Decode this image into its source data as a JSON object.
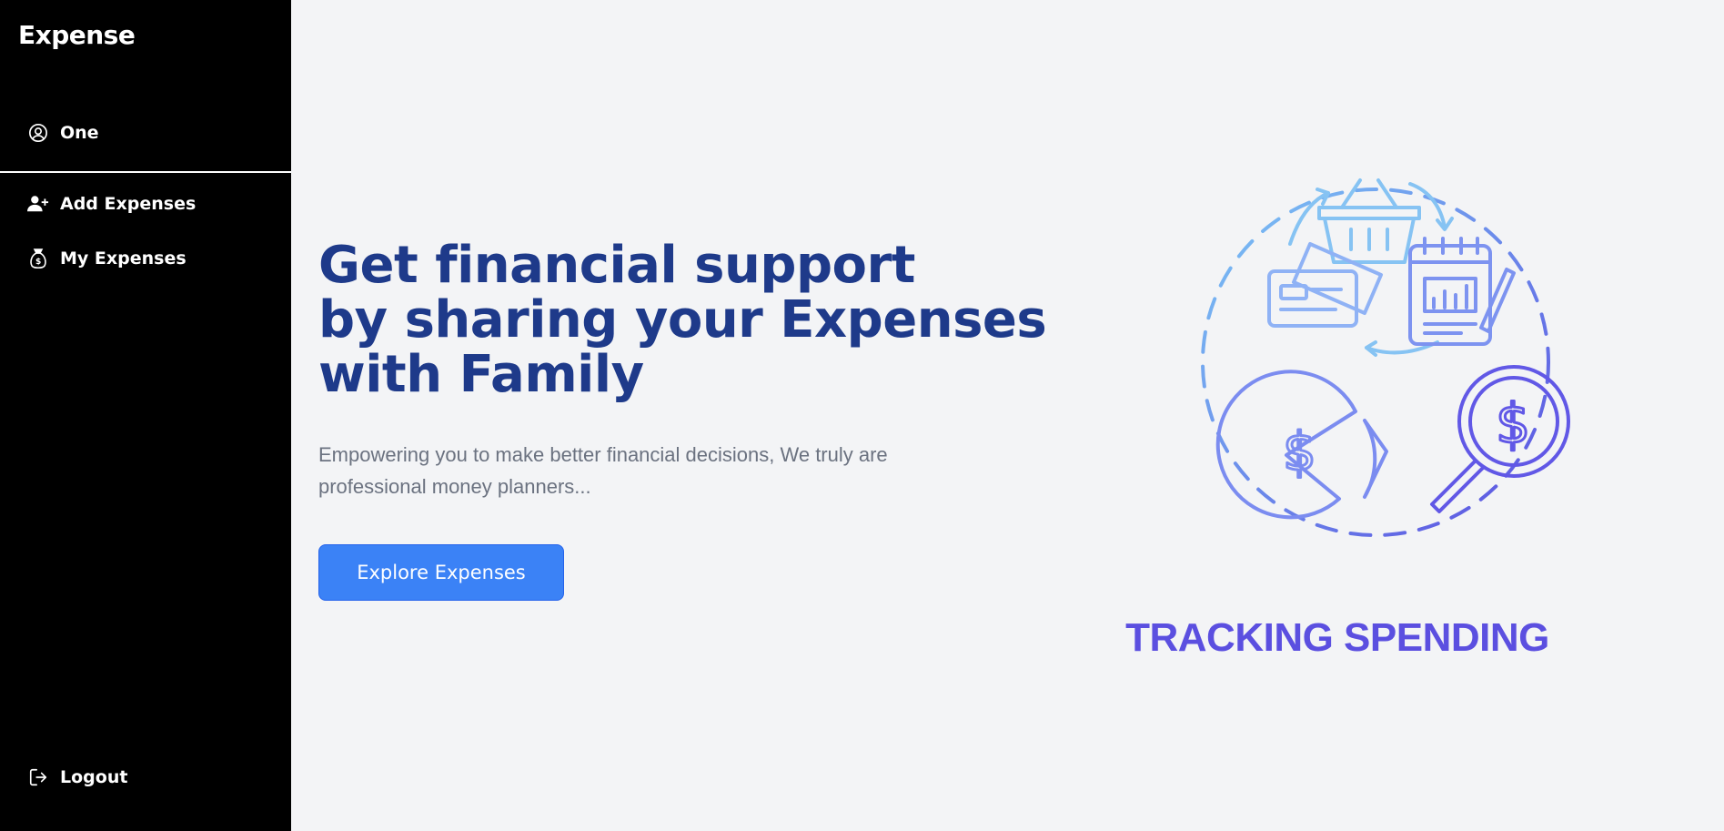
{
  "sidebar": {
    "brand": "Expense",
    "items": [
      {
        "label": "One",
        "icon": "user-circle-icon"
      },
      {
        "label": "Add Expenses",
        "icon": "add-user-icon"
      },
      {
        "label": "My Expenses",
        "icon": "money-bag-icon"
      }
    ],
    "logout": {
      "label": "Logout",
      "icon": "logout-icon"
    }
  },
  "hero": {
    "headline_lines": [
      "Get financial support",
      "by sharing your Expenses",
      "with Family"
    ],
    "subtext_lines": [
      "Empowering you to make better financial decisions, We truly are",
      "professional money planners..."
    ],
    "cta_label": "Explore Expenses"
  },
  "illustration": {
    "caption": "TRACKING SPENDING",
    "icons": [
      "shopping-basket-icon",
      "credit-cards-icon",
      "calendar-chart-icon",
      "pie-dollar-icon",
      "magnifier-dollar-icon"
    ]
  },
  "colors": {
    "sidebar_bg": "#000000",
    "page_bg": "#f3f4f6",
    "headline": "#1e3a8a",
    "subtext": "#6b7280",
    "button": "#3b82f6",
    "illustration_light": "#7cc6f5",
    "illustration_dark": "#5b4fe0"
  }
}
